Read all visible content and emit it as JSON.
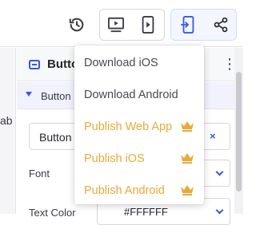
{
  "panel": {
    "title": "Butto",
    "section_label": "Button",
    "field_value": "Button",
    "clear_symbol": "×",
    "font_label": "Font",
    "text_color_label": "Text Color",
    "text_color_value": "#FFFFFF"
  },
  "left_pane": {
    "partial_text": "ab"
  },
  "dropdown": {
    "items": [
      {
        "label": "Download iOS",
        "pro": false
      },
      {
        "label": "Download Android",
        "pro": false
      },
      {
        "label": "Publish Web App",
        "pro": true
      },
      {
        "label": "Publish iOS",
        "pro": true
      },
      {
        "label": "Publish Android",
        "pro": true
      }
    ]
  },
  "icons": {
    "toolbar": [
      "history-icon",
      "preview-desktop-icon",
      "preview-mobile-icon",
      "mobile-export-icon",
      "share-icon"
    ],
    "pro_badge": "crown-icon",
    "panel": [
      "button-component-icon",
      "more-vert-icon",
      "collapse-caret-icon"
    ]
  },
  "colors": {
    "accent": "#3a59e0",
    "pro": "#e9a93a",
    "text": "#4a4a52",
    "active_group_bg": "#f3f6ff"
  }
}
